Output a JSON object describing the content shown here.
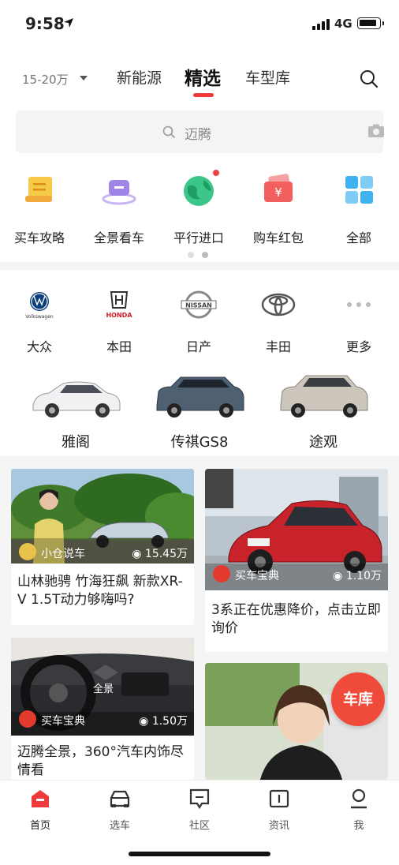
{
  "status": {
    "time": "9:58",
    "network": "4G"
  },
  "topnav": {
    "price_filter": "15-20万",
    "tabs": [
      {
        "label": "新能源"
      },
      {
        "label": "精选"
      },
      {
        "label": "车型库"
      }
    ]
  },
  "search": {
    "placeholder": "迈腾"
  },
  "quick_entries": [
    {
      "label": "买车攻略",
      "icon": "guide-icon"
    },
    {
      "label": "全景看车",
      "icon": "panorama-icon"
    },
    {
      "label": "平行进口",
      "icon": "globe-icon"
    },
    {
      "label": "购车红包",
      "icon": "red-envelope-icon"
    },
    {
      "label": "全部",
      "icon": "grid-icon"
    }
  ],
  "brands": [
    {
      "label": "大众",
      "logo_text": "Volkswagen"
    },
    {
      "label": "本田",
      "logo_text": "HONDA"
    },
    {
      "label": "日产",
      "logo_text": "NISSAN"
    },
    {
      "label": "丰田"
    },
    {
      "label": "更多"
    }
  ],
  "cars": [
    {
      "label": "雅阁"
    },
    {
      "label": "传祺GS8"
    },
    {
      "label": "途观"
    }
  ],
  "feed": [
    {
      "source": "小仓说车",
      "views": "15.45万",
      "title": "山林驰骋 竹海狂飙 新款XR-V 1.5T动力够嗨吗?"
    },
    {
      "source": "买车宝典",
      "views": "1.10万",
      "title": "3系正在优惠降价，点击立即询价",
      "overlay": "买车宝典"
    },
    {
      "source": "买车宝典",
      "views": "1.50万",
      "title": "迈腾全景，360°汽车内饰尽情看",
      "overlay": "全景"
    },
    {
      "source": "",
      "views": "",
      "title": ""
    }
  ],
  "fab": {
    "label": "车库"
  },
  "tabbar": [
    {
      "label": "首页"
    },
    {
      "label": "选车"
    },
    {
      "label": "社区"
    },
    {
      "label": "资讯"
    },
    {
      "label": "我"
    }
  ],
  "colors": {
    "accent": "#ee3a3a",
    "fab": "#f04b3a"
  }
}
